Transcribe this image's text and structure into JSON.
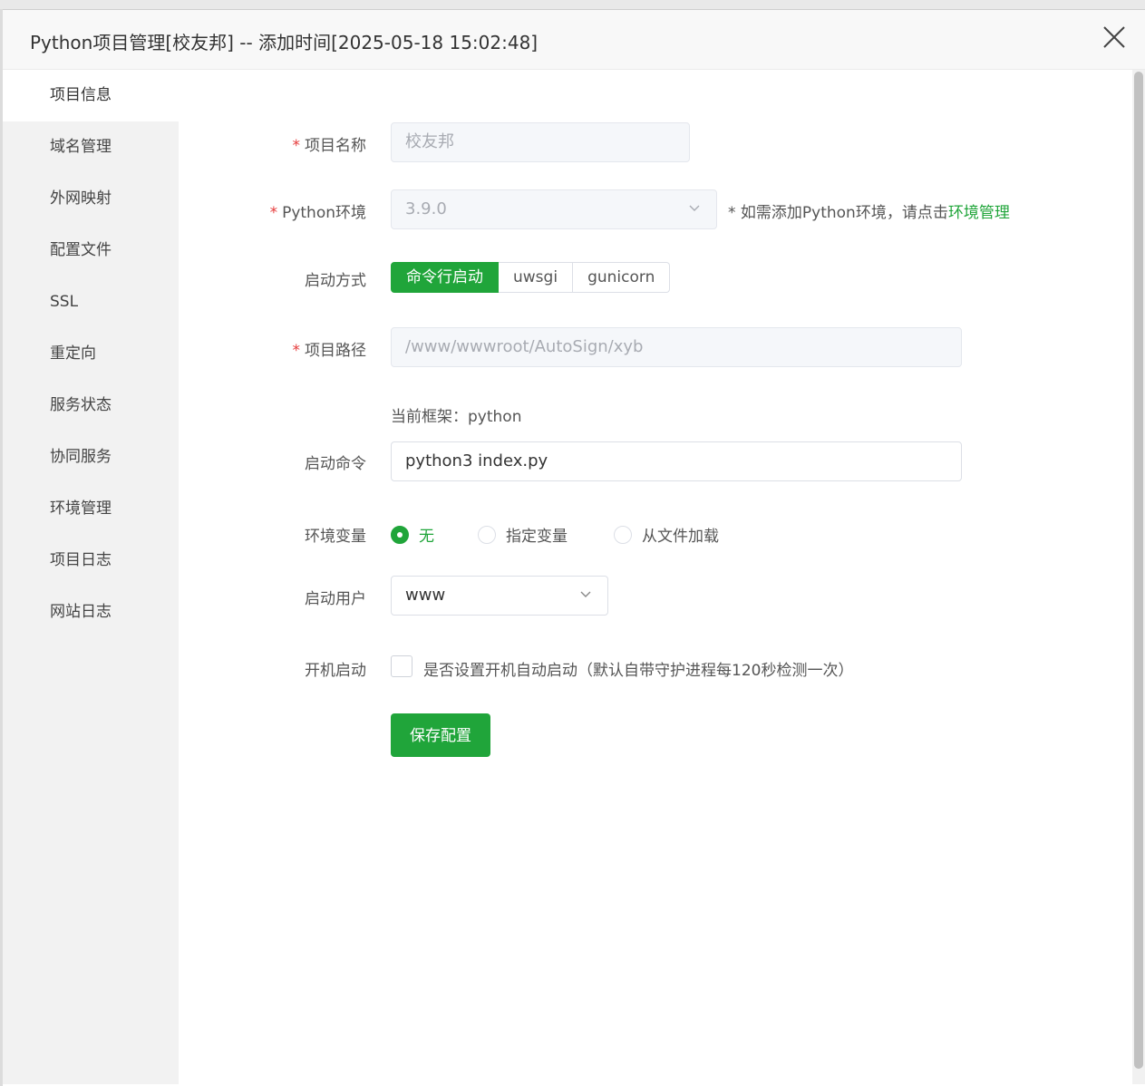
{
  "dialog": {
    "title": "Python项目管理[校友邦] -- 添加时间[2025-05-18 15:02:48]"
  },
  "sidebar": {
    "items": [
      {
        "label": "项目信息"
      },
      {
        "label": "域名管理"
      },
      {
        "label": "外网映射"
      },
      {
        "label": "配置文件"
      },
      {
        "label": "SSL"
      },
      {
        "label": "重定向"
      },
      {
        "label": "服务状态"
      },
      {
        "label": "协同服务"
      },
      {
        "label": "环境管理"
      },
      {
        "label": "项目日志"
      },
      {
        "label": "网站日志"
      }
    ],
    "active_index": 0
  },
  "form": {
    "required_mark": "*",
    "project_name": {
      "label": "项目名称",
      "value": "校友邦"
    },
    "python_env": {
      "label": "Python环境",
      "value": "3.9.0",
      "hint_prefix": "* 如需添加Python环境，请点击",
      "hint_link": "环境管理"
    },
    "start_mode": {
      "label": "启动方式",
      "options": [
        "命令行启动",
        "uwsgi",
        "gunicorn"
      ],
      "selected": "命令行启动"
    },
    "project_path": {
      "label": "项目路径",
      "value": "/www/wwwroot/AutoSign/xyb"
    },
    "framework_text": "当前框架：python",
    "start_command": {
      "label": "启动命令",
      "value": "python3 index.py"
    },
    "env_vars": {
      "label": "环境变量",
      "options": [
        "无",
        "指定变量",
        "从文件加载"
      ],
      "selected": "无"
    },
    "start_user": {
      "label": "启动用户",
      "value": "www"
    },
    "autostart": {
      "label": "开机启动",
      "text": "是否设置开机自动启动（默认自带守护进程每120秒检测一次）",
      "checked": false
    },
    "save_label": "保存配置"
  },
  "colors": {
    "accent": "#20a53a",
    "required": "#e63b3b",
    "sidebar_bg": "#f2f2f2"
  }
}
